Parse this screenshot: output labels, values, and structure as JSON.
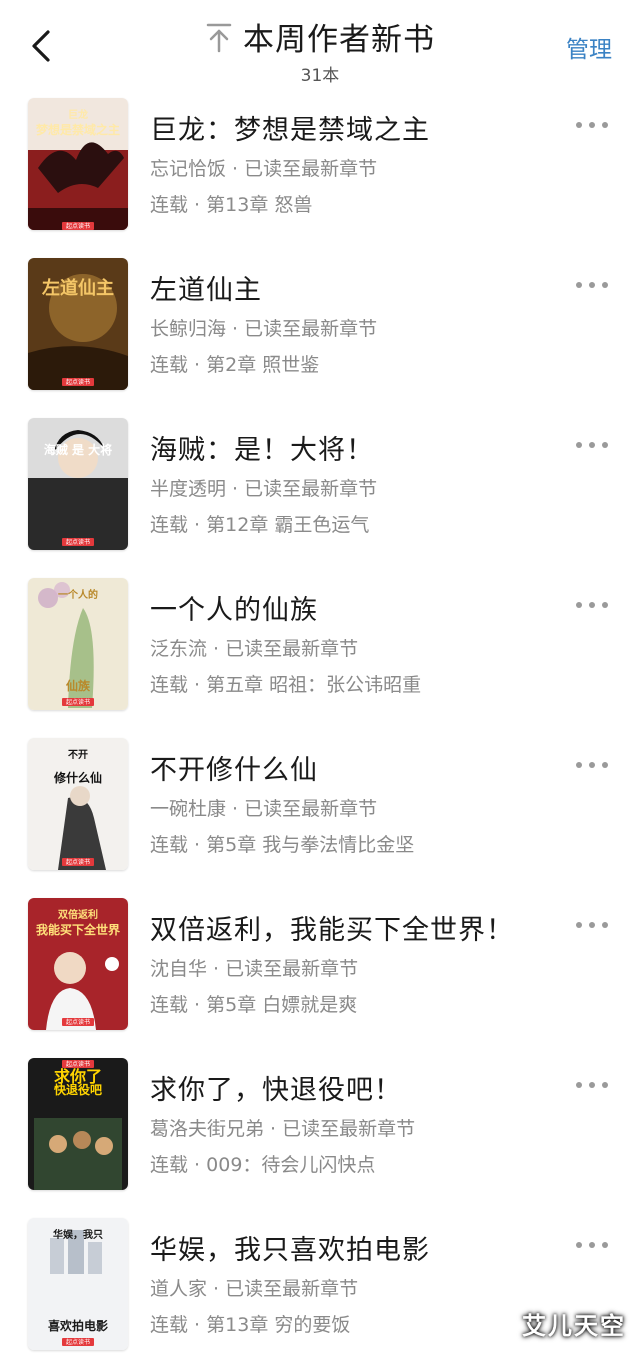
{
  "header": {
    "title": "本周作者新书",
    "count": "31本",
    "manage_label": "管理"
  },
  "books": [
    {
      "title": "巨龙：梦想是禁域之主",
      "author": "忘记恰饭",
      "progress": "已读至最新章节",
      "status": "连载",
      "chapter": "第13章 怒兽",
      "cover": {
        "top": "巨龙",
        "main": "梦想是禁域之主",
        "bg": "#8b1e1e"
      }
    },
    {
      "title": "左道仙主",
      "author": "长鲸归海",
      "progress": "已读至最新章节",
      "status": "连载",
      "chapter": "第2章 照世鉴",
      "cover": {
        "top": "",
        "main": "左道仙主",
        "bg": "#5a3a18"
      }
    },
    {
      "title": "海贼：是！大将！",
      "author": "半度透明",
      "progress": "已读至最新章节",
      "status": "连载",
      "chapter": "第12章 霸王色运气",
      "cover": {
        "top": "",
        "main": "海贼 是 大将",
        "bg": "#2a2a2a"
      }
    },
    {
      "title": "一个人的仙族",
      "author": "泛东流",
      "progress": "已读至最新章节",
      "status": "连载",
      "chapter": "第五章 昭祖：张公讳昭重",
      "cover": {
        "top": "一个人的",
        "main": "仙族",
        "bg": "#efe9d6"
      }
    },
    {
      "title": "不开修什么仙",
      "author": "一碗杜康",
      "progress": "已读至最新章节",
      "status": "连载",
      "chapter": "第5章 我与拳法情比金坚",
      "cover": {
        "top": "不开",
        "main": "修什么仙",
        "bg": "#f3f1ee"
      }
    },
    {
      "title": "双倍返利，我能买下全世界！",
      "author": "沈自华",
      "progress": "已读至最新章节",
      "status": "连载",
      "chapter": "第5章 白嫖就是爽",
      "cover": {
        "top": "双倍返利",
        "main": "我能买下全世界",
        "bg": "#a8242a"
      }
    },
    {
      "title": "求你了，快退役吧！",
      "author": "葛洛夫街兄弟",
      "progress": "已读至最新章节",
      "status": "连载",
      "chapter": "009：待会儿闪快点",
      "cover": {
        "top": "求你了",
        "main": "快退役吧",
        "bg": "#1a1a1a"
      }
    },
    {
      "title": "华娱，我只喜欢拍电影",
      "author": "道人家",
      "progress": "已读至最新章节",
      "status": "连载",
      "chapter": "第13章 穷的要饭",
      "cover": {
        "top": "华娱，我只",
        "main": "喜欢拍电影",
        "bg": "#f2f3f5"
      }
    }
  ],
  "publisher_badge": "起点读书",
  "watermark": "艾儿天空",
  "colors": {
    "accent": "#3a82c4",
    "meta": "#8a8a8a",
    "badge": "#e4393c"
  }
}
